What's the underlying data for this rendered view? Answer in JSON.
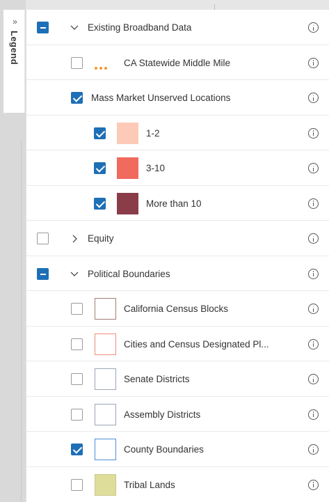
{
  "legend_tab": {
    "label": "Legend",
    "collapse_glyph": "»"
  },
  "colors": {
    "accent": "#1e6fb6",
    "middle_mile": "#f39a2a",
    "unserved_1_2": "#fccab7",
    "unserved_3_10": "#f16a5e",
    "unserved_more_10": "#8a3c49",
    "census_blocks_outline": "#a07b74",
    "cities_outline": "#ef8c7a",
    "senate_outline": "#9aa6b2",
    "assembly_outline": "#9aa6b2",
    "county_outline": "#4f8cd6",
    "tribal_fill": "#dede9a"
  },
  "rows": [
    {
      "label": "Existing Broadband Data",
      "checkbox": "indeterminate",
      "caret": "chevron-down-icon"
    },
    {
      "label": "CA Statewide Middle Mile",
      "checkbox": "unchecked",
      "symbol": "dotted-line"
    },
    {
      "label": "Mass Market Unserved Locations",
      "checkbox": "checked"
    },
    {
      "label": "1-2",
      "checkbox": "checked",
      "symbol": "fill-swatch"
    },
    {
      "label": "3-10",
      "checkbox": "checked",
      "symbol": "fill-swatch"
    },
    {
      "label": "More than 10",
      "checkbox": "checked",
      "symbol": "fill-swatch"
    },
    {
      "label": "Equity",
      "checkbox": "unchecked",
      "caret": "chevron-right-icon"
    },
    {
      "label": "Political Boundaries",
      "checkbox": "indeterminate",
      "caret": "chevron-down-icon"
    },
    {
      "label": "California Census Blocks",
      "checkbox": "unchecked",
      "symbol": "outline-swatch"
    },
    {
      "label": "Cities and Census Designated Pl...",
      "checkbox": "unchecked",
      "symbol": "outline-swatch"
    },
    {
      "label": "Senate Districts",
      "checkbox": "unchecked",
      "symbol": "outline-swatch"
    },
    {
      "label": "Assembly Districts",
      "checkbox": "unchecked",
      "symbol": "outline-swatch"
    },
    {
      "label": "County Boundaries",
      "checkbox": "checked",
      "symbol": "outline-swatch"
    },
    {
      "label": "Tribal Lands",
      "checkbox": "unchecked",
      "symbol": "fill-swatch"
    }
  ]
}
